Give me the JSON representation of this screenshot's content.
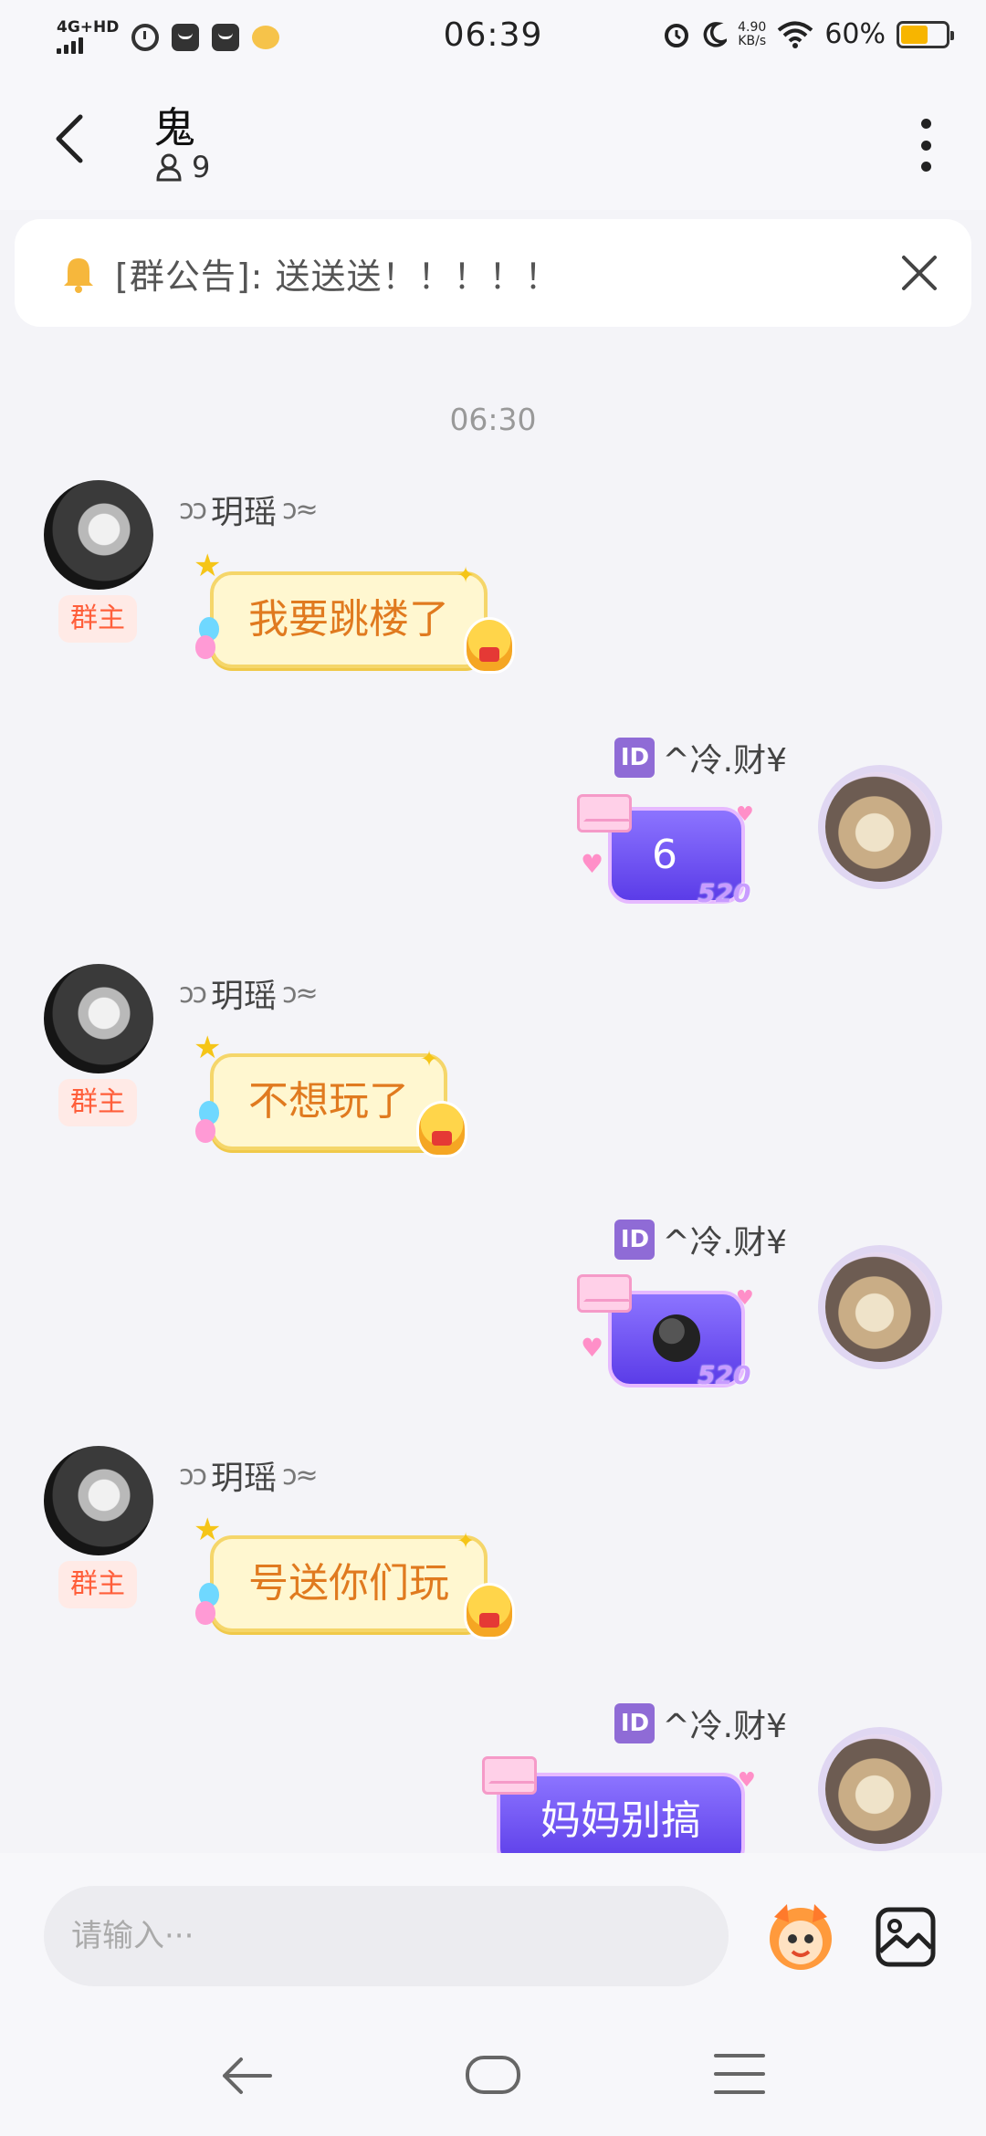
{
  "status_bar": {
    "network": "4G+HD",
    "time": "06:39",
    "speed_value": "4.90",
    "speed_unit": "KB/s",
    "battery_percent": "60%",
    "battery_level": 0.6,
    "battery_color": "#f7b500"
  },
  "header": {
    "title": "鬼",
    "member_count": "9"
  },
  "notice": {
    "text": "[群公告]: 送送送！！！！！"
  },
  "timestamp": "06:30",
  "messages": [
    {
      "side": "left",
      "sender": "玥瑶",
      "badge": "群主",
      "text": "我要跳楼了"
    },
    {
      "side": "right",
      "sender": "^冷.财¥",
      "id_tag": "ID",
      "text": "6",
      "tag": "520"
    },
    {
      "side": "left",
      "sender": "玥瑶",
      "badge": "群主",
      "text": "不想玩了"
    },
    {
      "side": "right",
      "sender": "^冷.财¥",
      "id_tag": "ID",
      "text": "",
      "emoji": "smirk-emoji",
      "tag": "520"
    },
    {
      "side": "left",
      "sender": "玥瑶",
      "badge": "群主",
      "text": "号送你们玩"
    },
    {
      "side": "right",
      "sender": "^冷.财¥",
      "id_tag": "ID",
      "text": "妈妈别搞"
    }
  ],
  "input": {
    "placeholder": "请输入···"
  },
  "colors": {
    "accent_purple": "#5b3ce8",
    "bubble_yellow": "#fff7d0",
    "owner_badge": "#ff5e3a"
  }
}
